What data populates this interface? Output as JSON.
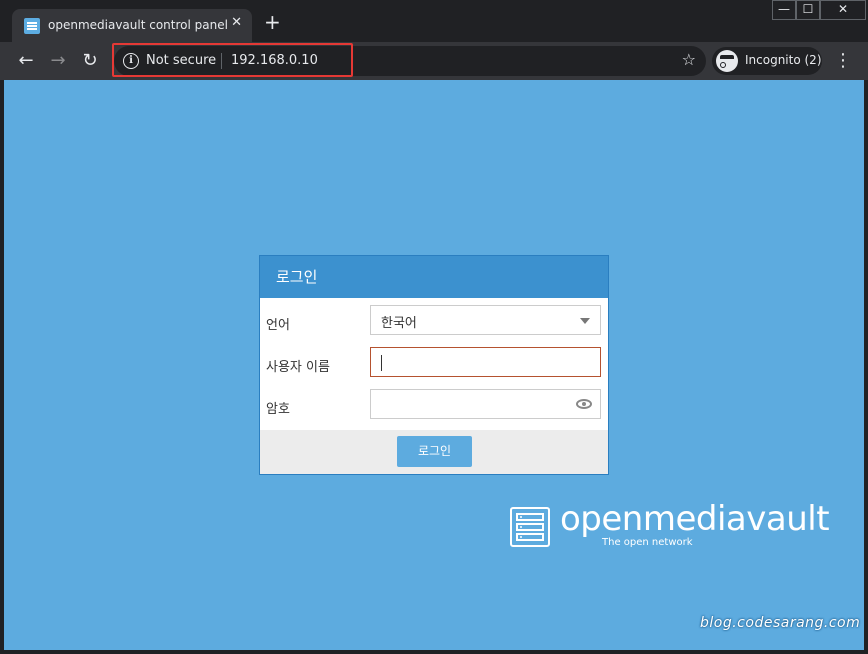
{
  "browser": {
    "tab_title": "openmediavault control panel - r",
    "tab_close": "✕",
    "new_tab": "+",
    "window": {
      "minimize": "—",
      "maximize": "☐",
      "close": "✕"
    },
    "nav": {
      "back": "←",
      "forward": "→",
      "reload": "↻"
    },
    "security_label": "Not secure",
    "info_glyph": "i",
    "url": "192.168.0.10",
    "bookmark_glyph": "☆",
    "incognito_label": "Incognito (2)",
    "menu_glyph": "⋮"
  },
  "login": {
    "title": "로그인",
    "language_label": "언어",
    "language_value": "한국어",
    "username_label": "사용자 이름",
    "username_value": "",
    "password_label": "암호",
    "password_value": "",
    "submit_label": "로그인"
  },
  "branding": {
    "name": "openmediavault",
    "tagline": "The open network"
  },
  "watermark": "blog.codesarang.com",
  "colors": {
    "page_bg": "#5dabdf",
    "dialog_header": "#3c91cf",
    "highlight_box": "#e53935"
  }
}
